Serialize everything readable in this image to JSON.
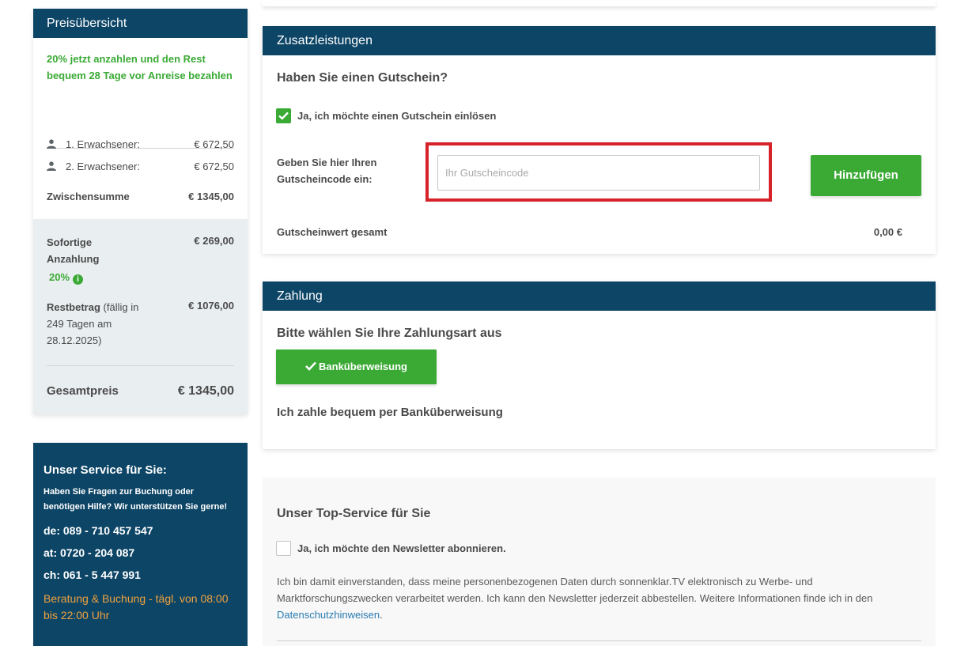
{
  "price_overview": {
    "title": "Preisübersicht",
    "promo": "20% jetzt anzahlen und den Rest bequem 28 Tage vor Anreise bezahlen",
    "adults": [
      {
        "label": "1. Erwachsener:",
        "price": "€ 672,50"
      },
      {
        "label": "2. Erwachsener:",
        "price": "€ 672,50"
      }
    ],
    "subtotal_label": "Zwischensumme",
    "subtotal_value": "€ 1345,00",
    "deposit_label": "Sofortige Anzahlung",
    "deposit_value": "€ 269,00",
    "deposit_percent": "20%",
    "rest_label_bold": "Restbetrag",
    "rest_label_rest": " (fällig in 249 Tagen am 28.12.2025)",
    "rest_value": "€ 1076,00",
    "total_label": "Gesamtpreis",
    "total_value": "€ 1345,00"
  },
  "service": {
    "title": "Unser Service für Sie:",
    "desc": "Haben Sie Fragen zur Buchung oder benötigen Hilfe? Wir unterstützen Sie gerne!",
    "phones": [
      "de: 089 - 710 457 547",
      "at: 0720 - 204 087",
      "ch: 061 - 5 447 991"
    ],
    "hours": "Beratung & Buchung - tägl. von 08:00 bis 22:00 Uhr"
  },
  "extras": {
    "header": "Zusatzleistungen",
    "voucher_question": "Haben Sie einen Gutschein?",
    "voucher_checkbox_label": "Ja, ich möchte einen Gutschein einlösen",
    "voucher_field_label": "Geben Sie hier Ihren Gutscheincode ein:",
    "voucher_placeholder": "Ihr Gutscheincode",
    "add_button": "Hinzufügen",
    "voucher_total_label": "Gutscheinwert gesamt",
    "voucher_total_value": "0,00 €"
  },
  "payment": {
    "header": "Zahlung",
    "prompt": "Bitte wählen Sie Ihre Zahlungsart aus",
    "method_button": "Banküberweisung",
    "method_desc": "Ich zahle bequem per Banküberweisung"
  },
  "top_service": {
    "title": "Unser Top-Service für Sie",
    "newsletter_label": "Ja, ich möchte den Newsletter abonnieren.",
    "consent_text": "Ich bin damit einverstanden, dass meine personenbezogenen Daten durch sonnenklar.TV elektronisch zu Werbe- und Marktforschungszwecken verarbeitet werden. Ich kann den Newsletter jederzeit abbestellen. Weitere Informationen finde ich in den ",
    "privacy_link": "Datenschutzhinweisen",
    "consent_end": "."
  },
  "colors": {
    "navy": "#0d4566",
    "green": "#3aaa35",
    "orange": "#f0a23e",
    "highlight_red": "#d7222a"
  }
}
